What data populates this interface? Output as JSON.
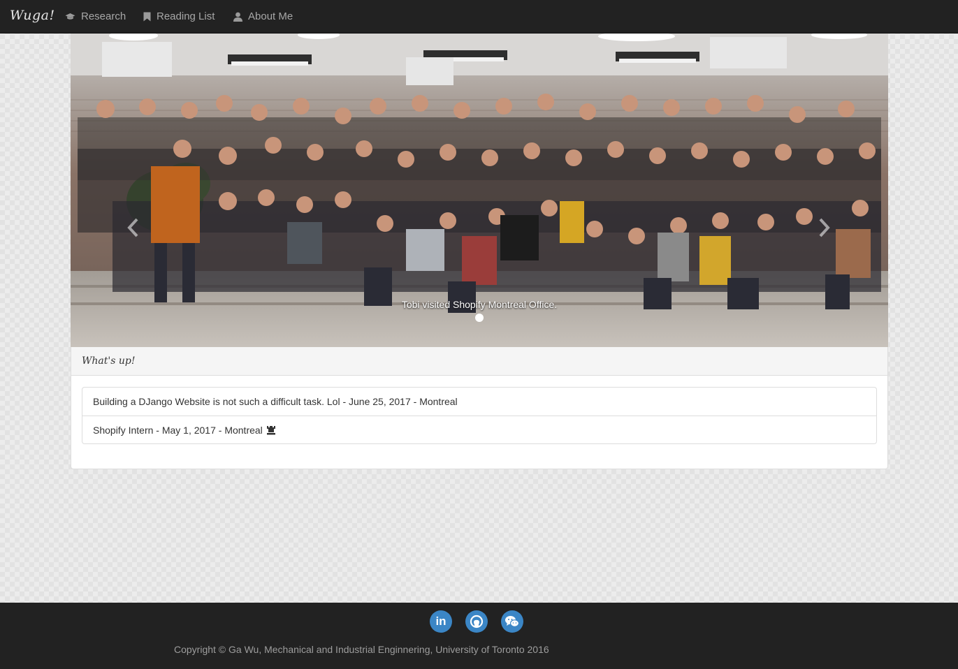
{
  "navbar": {
    "brand": "Wuga!",
    "items": [
      {
        "label": "Research",
        "icon": "graduation-cap-icon"
      },
      {
        "label": "Reading List",
        "icon": "bookmark-icon"
      },
      {
        "label": "About Me",
        "icon": "user-icon"
      }
    ]
  },
  "carousel": {
    "caption": "Tobi visited Shopify Montreal Office.",
    "slide_count": 1,
    "active_slide": 1
  },
  "whats_up": {
    "heading": "What's up!",
    "items": [
      {
        "text": "Building a DJango Website is not such a difficult task. Lol - June 25, 2017 - Montreal"
      },
      {
        "text": "Shopify Intern - May 1, 2017 - Montreal",
        "icon": "chess-rook-icon"
      }
    ]
  },
  "footer": {
    "social": [
      {
        "name": "linkedin",
        "icon": "linkedin-icon",
        "glyph": "in"
      },
      {
        "name": "github",
        "icon": "github-icon"
      },
      {
        "name": "wechat",
        "icon": "wechat-icon"
      }
    ],
    "copyright": "Copyright © Ga Wu, Mechanical and Industrial Enginnering, University of Toronto 2016"
  },
  "colors": {
    "navbar_bg": "#222222",
    "social_bg": "#3b86c6",
    "panel_heading_bg": "#f5f5f5"
  }
}
